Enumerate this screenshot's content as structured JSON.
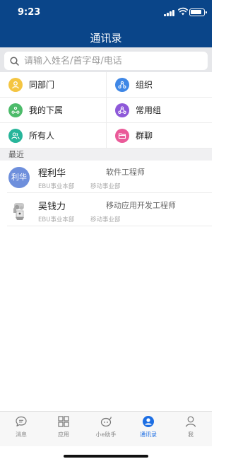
{
  "status": {
    "time": "9:23"
  },
  "header": {
    "title": "通讯录"
  },
  "search": {
    "placeholder": "请输入姓名/首字母/电话"
  },
  "groups": [
    {
      "label": "同部门",
      "icon": "person-icon",
      "color": "#f4c542"
    },
    {
      "label": "组织",
      "icon": "org-icon",
      "color": "#3f87e6"
    },
    {
      "label": "我的下属",
      "icon": "subordinates-icon",
      "color": "#4cbb6a"
    },
    {
      "label": "常用组",
      "icon": "group-icon",
      "color": "#8e59d9"
    },
    {
      "label": "所有人",
      "icon": "people-icon",
      "color": "#27b59a"
    },
    {
      "label": "群聊",
      "icon": "folder-icon",
      "color": "#ea5a99"
    }
  ],
  "recent": {
    "label": "最近",
    "contacts": [
      {
        "avatar_text": "利华",
        "name": "程利华",
        "title": "软件工程师",
        "dept": "EBU事业本部",
        "unit": "移动事业部"
      },
      {
        "avatar_text": "",
        "name": "吴钱力",
        "title": "移动应用开发工程师",
        "dept": "EBU事业本部",
        "unit": "移动事业部"
      }
    ]
  },
  "tabs": [
    {
      "label": "消息",
      "icon": "chat-icon",
      "active": false
    },
    {
      "label": "应用",
      "icon": "apps-icon",
      "active": false
    },
    {
      "label": "小e助手",
      "icon": "assistant-icon",
      "active": false
    },
    {
      "label": "通讯录",
      "icon": "contacts-icon",
      "active": true
    },
    {
      "label": "我",
      "icon": "me-icon",
      "active": false
    }
  ],
  "colors": {
    "header": "#0a4589",
    "active_tab": "#1c6ee3"
  }
}
